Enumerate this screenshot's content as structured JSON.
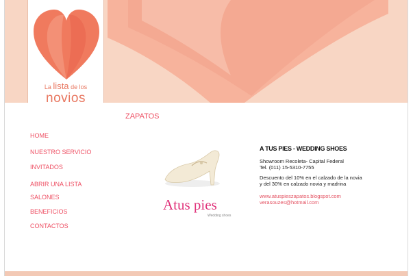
{
  "logo": {
    "small_prefix": "La",
    "small_word": "lista",
    "small_suffix": "de los",
    "main": "novios"
  },
  "section_title": "ZAPATOS",
  "nav": {
    "items": [
      {
        "label": "HOME"
      },
      {
        "label": "NUESTRO SERVICIO"
      },
      {
        "label": "INVITADOS"
      },
      {
        "label": "ABRIR UNA LISTA"
      },
      {
        "label": "SALONES"
      },
      {
        "label": "BENEFICIOS"
      },
      {
        "label": "CONTACTOS"
      }
    ]
  },
  "product": {
    "brand_name": "Atus pies",
    "brand_sub": "Wedding shoes",
    "title": "A TUS PIES - WEDDING SHOES",
    "address_line1": "Showroom Recoleta- Capital Federal",
    "address_line2": "Tel. (011) 15-5310-7755",
    "discount": "Descuento del 10% en el calzado de la novia y del 30% en calzado novia y madrina",
    "link_blog": "www.atuspieszapatos.blogspot.com",
    "link_email": "verasouzes@hotmail.com"
  },
  "colors": {
    "header_bg": "#f8d6c4",
    "accent": "#ee4f63",
    "heart": "#f07a5e",
    "brand": "#e0337b"
  }
}
